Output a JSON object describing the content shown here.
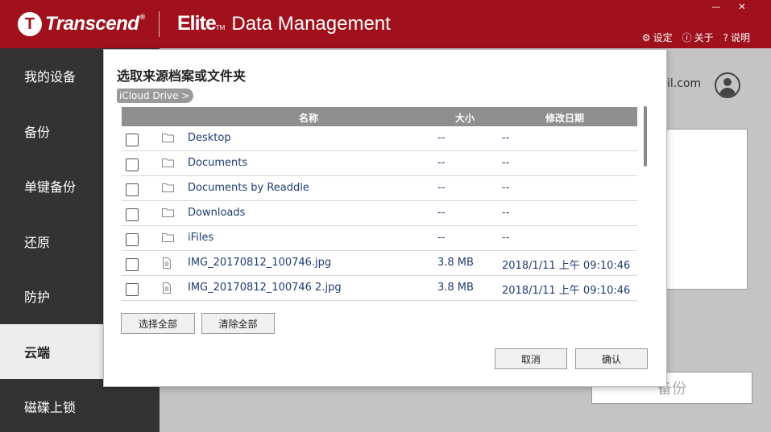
{
  "header": {
    "brand_mark": "T",
    "brand_name": "Transcend",
    "brand_reg": "®",
    "product_elite": "Elite",
    "product_tm": "TM",
    "product_rest": "Data Management",
    "window_minimize": "—",
    "window_close": "✕",
    "links": [
      {
        "icon": "⚙",
        "label": "设定"
      },
      {
        "icon": "ⓘ",
        "label": "关于"
      },
      {
        "icon": "?",
        "label": "说明"
      }
    ]
  },
  "sidebar": {
    "items": [
      {
        "label": "我的设备"
      },
      {
        "label": "备份"
      },
      {
        "label": "单键备份"
      },
      {
        "label": "还原"
      },
      {
        "label": "防护"
      },
      {
        "label": "云端",
        "active": true
      },
      {
        "label": "磁碟上锁"
      }
    ]
  },
  "main": {
    "email_partial": "il.com",
    "backup_button": "备份"
  },
  "dialog": {
    "title": "选取来源档案或文件夹",
    "breadcrumb": "iCloud Drive >",
    "columns": {
      "name": "名称",
      "size": "大小",
      "modified": "修改日期"
    },
    "rows": [
      {
        "type": "folder",
        "name": "Desktop",
        "size": "--",
        "modified": "--"
      },
      {
        "type": "folder",
        "name": "Documents",
        "size": "--",
        "modified": "--"
      },
      {
        "type": "folder",
        "name": "Documents by Readdle",
        "size": "--",
        "modified": "--"
      },
      {
        "type": "folder",
        "name": "Downloads",
        "size": "--",
        "modified": "--"
      },
      {
        "type": "folder",
        "name": "iFiles",
        "size": "--",
        "modified": "--"
      },
      {
        "type": "file",
        "name": "IMG_20170812_100746.jpg",
        "size": "3.8 MB",
        "modified": "2018/1/11 上午 09:10:46"
      },
      {
        "type": "file",
        "name": "IMG_20170812_100746 2.jpg",
        "size": "3.8 MB",
        "modified": "2018/1/11 上午 09:10:46"
      }
    ],
    "select_all": "选择全部",
    "clear_all": "清除全部",
    "cancel": "取消",
    "confirm": "确认"
  }
}
